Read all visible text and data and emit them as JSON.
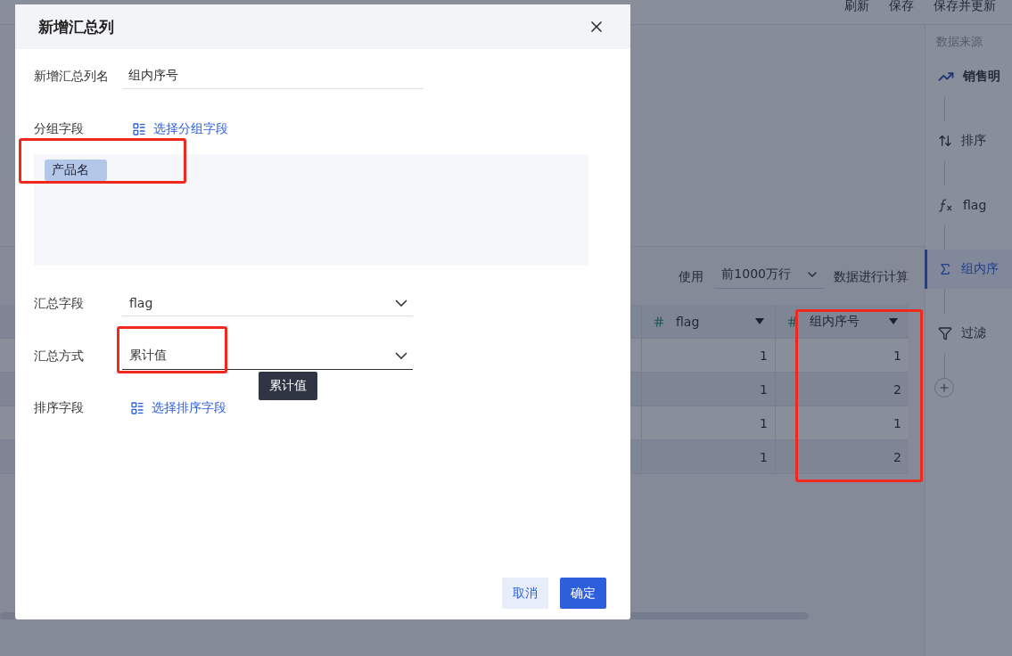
{
  "toolbar": {
    "buttons": [
      "刷新",
      "保存",
      "保存并更新"
    ]
  },
  "sidebar": {
    "title": "数据来源",
    "steps": [
      {
        "kind": "source",
        "label": "销售明",
        "selected": false
      },
      {
        "kind": "sort",
        "label": "排序",
        "selected": false
      },
      {
        "kind": "formula",
        "label": "flag",
        "selected": false
      },
      {
        "kind": "sum",
        "label": "组内序",
        "selected": true
      },
      {
        "kind": "filter",
        "label": "过滤",
        "selected": false
      }
    ]
  },
  "calc_bar": {
    "prefix": "使用",
    "select": "前1000万行",
    "suffix": "数据进行计算"
  },
  "table": {
    "columns": [
      {
        "name": "flag"
      },
      {
        "name": "组内序号"
      }
    ],
    "rows": [
      [
        "1",
        "1"
      ],
      [
        "1",
        "2"
      ],
      [
        "1",
        "1"
      ],
      [
        "1",
        "2"
      ]
    ]
  },
  "dialog": {
    "title": "新增汇总列",
    "name_field": {
      "label": "新增汇总列名",
      "value": "组内序号"
    },
    "group_field": {
      "label": "分组字段",
      "link": "选择分组字段",
      "tags": [
        "产品名"
      ]
    },
    "sum_field": {
      "label": "汇总字段",
      "value": "flag"
    },
    "method_field": {
      "label": "汇总方式",
      "value": "累计值",
      "focused": true
    },
    "sort_field": {
      "label": "排序字段",
      "link": "选择排序字段"
    },
    "tooltip": "累计值",
    "buttons": {
      "cancel": "取消",
      "ok": "确定"
    }
  }
}
